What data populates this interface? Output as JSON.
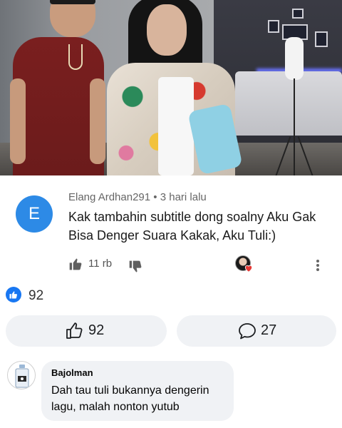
{
  "video": {
    "scene": "video-frame"
  },
  "comment": {
    "avatar_letter": "E",
    "author": "Elang Ardhan291",
    "separator": "•",
    "time": "3 hari lalu",
    "text": "Kak tambahin subtitle dong soalny Aku Gak Bisa Denger Suara Kakak, Aku Tuli:)",
    "like_count": "11 rb",
    "icons": {
      "like": "thumbs-up-icon",
      "dislike": "thumbs-down-icon",
      "creator_heart": "creator-heart-icon",
      "more": "more-vertical-icon"
    },
    "colors": {
      "avatar_bg": "#2d8ae6",
      "heart": "#e53935"
    }
  },
  "post": {
    "reaction_count": "92",
    "like_button_count": "92",
    "comment_button_count": "27",
    "icons": {
      "reaction": "like-reaction-icon",
      "like_button": "thumbs-up-outline-icon",
      "comment_button": "comment-bubble-icon"
    },
    "colors": {
      "reaction_blue": "#1877f2",
      "pill_bg": "#f0f2f5"
    }
  },
  "reply": {
    "author": "Bajolman",
    "text": "Dah tau tuli bukannya dengerin lagu, malah nonton yutub",
    "avatar_icon": "water-bottle-avatar-icon"
  }
}
